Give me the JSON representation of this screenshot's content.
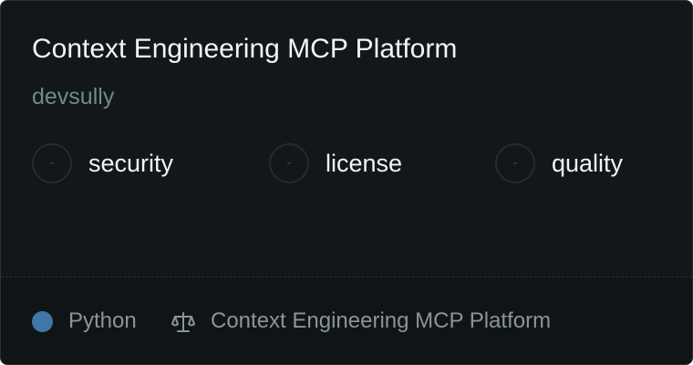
{
  "card": {
    "title": "Context Engineering MCP Platform",
    "owner": "devsully",
    "badges": [
      {
        "symbol": "-",
        "label": "security"
      },
      {
        "symbol": "-",
        "label": "license"
      },
      {
        "symbol": "-",
        "label": "quality"
      }
    ],
    "footer": {
      "language": "Python",
      "language_color": "#3f78a8",
      "license_icon": "scale-icon",
      "license": "Context Engineering MCP Platform"
    }
  },
  "colors": {
    "card_background": "#121719",
    "footer_background": "#0f1416",
    "title_text": "#f2f4f5",
    "owner_text": "#6f8c84",
    "muted_text": "#8b9499"
  }
}
